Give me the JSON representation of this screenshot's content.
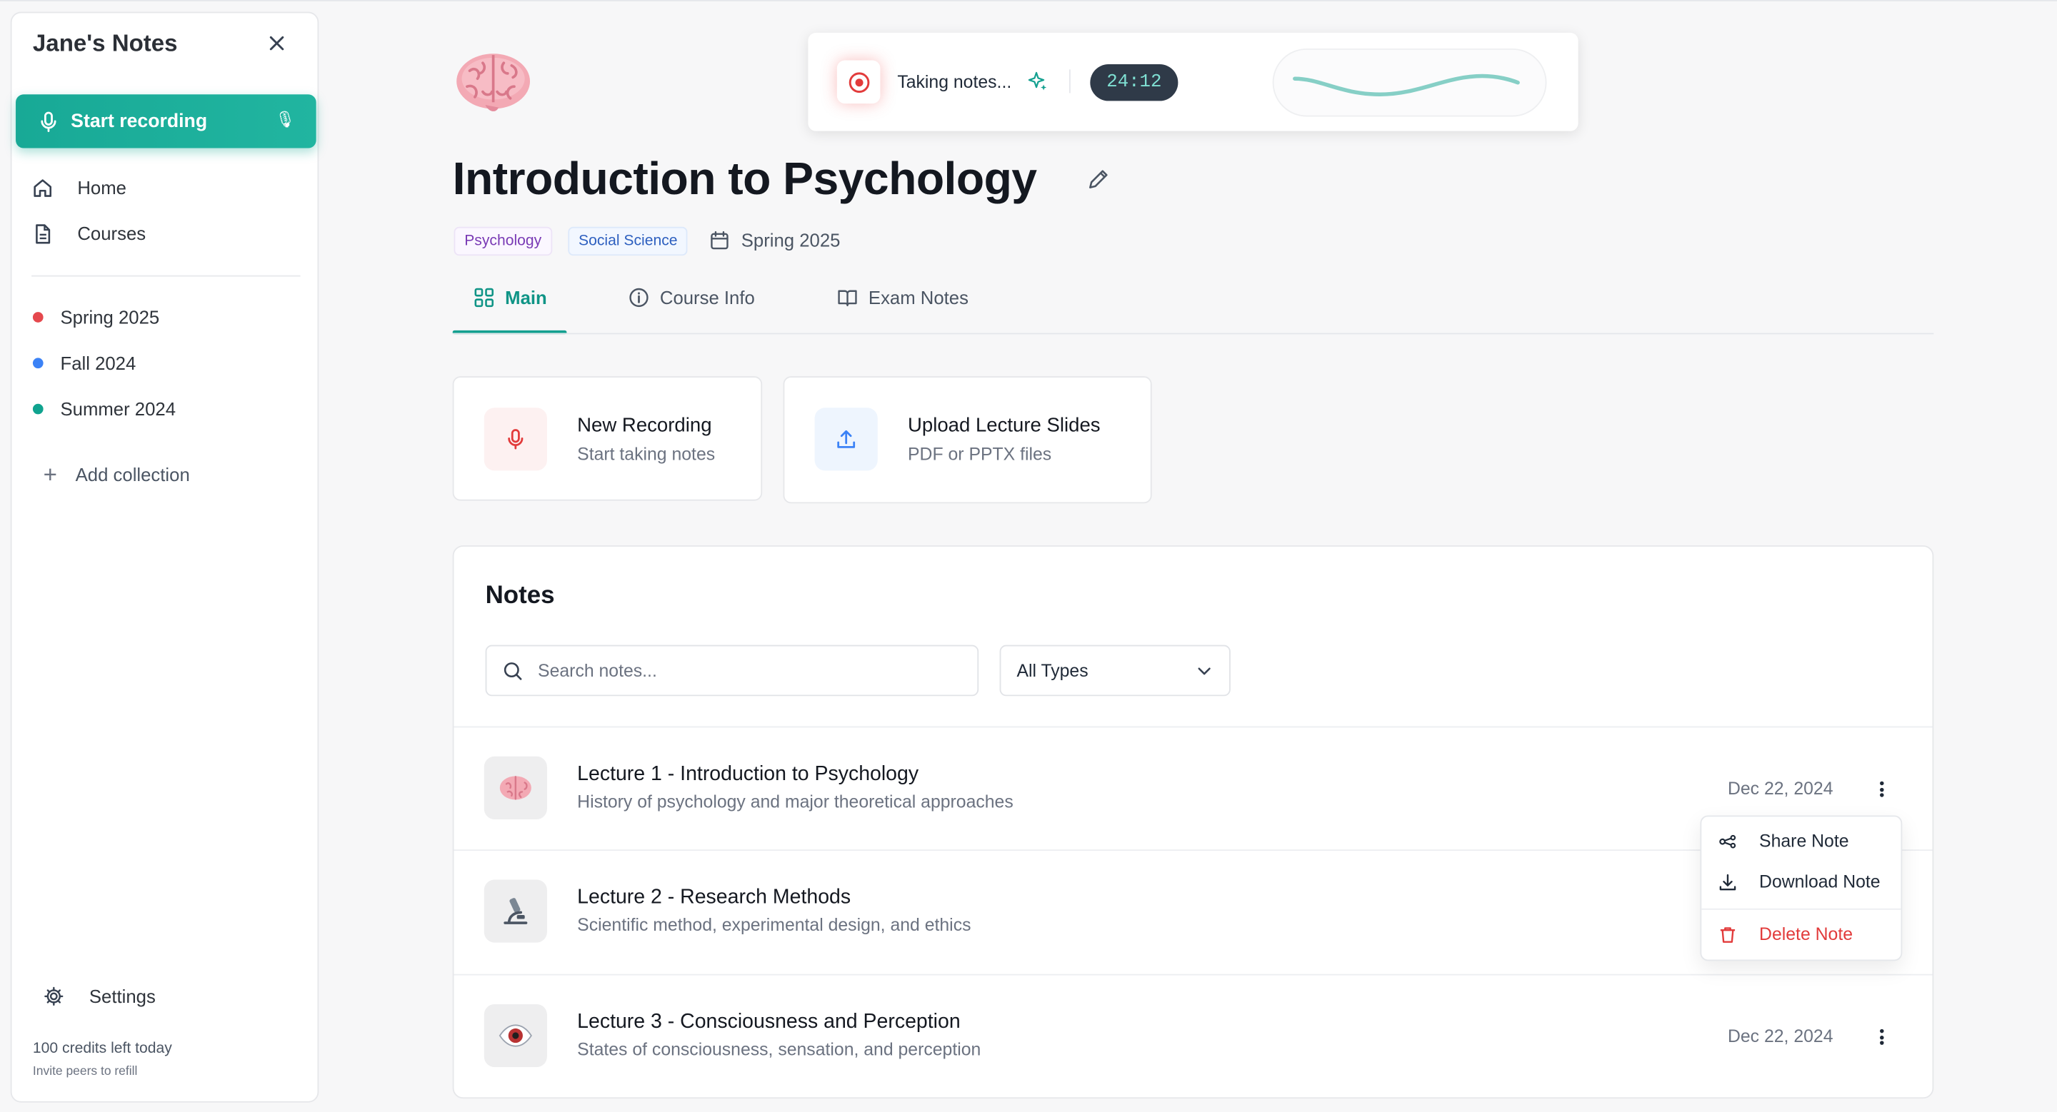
{
  "sidebar": {
    "title": "Jane's Notes",
    "record_label": "Start recording",
    "nav": [
      {
        "label": "Home"
      },
      {
        "label": "Courses"
      }
    ],
    "collections": [
      {
        "label": "Spring 2025",
        "color": "#e5484d"
      },
      {
        "label": "Fall 2024",
        "color": "#3b82f6"
      },
      {
        "label": "Summer 2024",
        "color": "#10a38f"
      }
    ],
    "add_collection": "Add collection",
    "settings": "Settings",
    "credits": "100 credits left today",
    "invite": "Invite peers to refill"
  },
  "course": {
    "title": "Introduction to Psychology",
    "tags": [
      "Psychology",
      "Social Science"
    ],
    "term": "Spring 2025"
  },
  "tabs": [
    {
      "label": "Main",
      "active": true
    },
    {
      "label": "Course Info",
      "active": false
    },
    {
      "label": "Exam Notes",
      "active": false
    }
  ],
  "actions": [
    {
      "title": "New Recording",
      "subtitle": "Start taking notes"
    },
    {
      "title": "Upload Lecture Slides",
      "subtitle": "PDF or PPTX files"
    }
  ],
  "notes": {
    "title": "Notes",
    "search_placeholder": "Search notes...",
    "filter_selected": "All Types",
    "items": [
      {
        "title": "Lecture 1 - Introduction to Psychology",
        "desc": "History of psychology and major theoretical approaches",
        "date": "Dec 22, 2024",
        "icon": "brain-icon"
      },
      {
        "title": "Lecture 2 - Research Methods",
        "desc": "Scientific method, experimental design, and ethics",
        "date": "",
        "icon": "microscope-icon"
      },
      {
        "title": "Lecture 3 - Consciousness and Perception",
        "desc": "States of consciousness, sensation, and perception",
        "date": "Dec 22, 2024",
        "icon": "eye-icon"
      }
    ]
  },
  "menu": {
    "share": "Share Note",
    "download": "Download Note",
    "delete": "Delete Note"
  },
  "recorder": {
    "status": "Taking notes...",
    "timer": "24:12"
  },
  "colors": {
    "accent": "#14a090",
    "danger": "#e23b3b",
    "timer_bg": "#2f3a48"
  }
}
